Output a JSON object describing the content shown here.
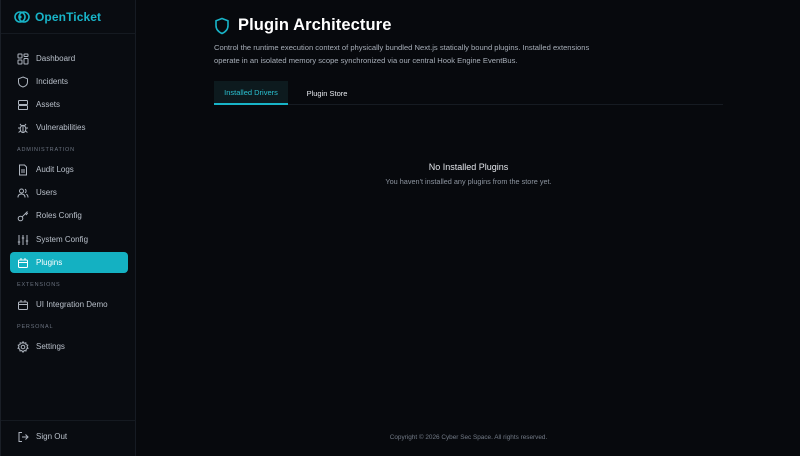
{
  "brand": {
    "name": "OpenTicket",
    "accent": "#18b4c8"
  },
  "sidebar": {
    "items": [
      {
        "label": "Dashboard",
        "icon": "dashboard-icon"
      },
      {
        "label": "Incidents",
        "icon": "shield-icon"
      },
      {
        "label": "Assets",
        "icon": "server-icon"
      },
      {
        "label": "Vulnerabilities",
        "icon": "bug-icon"
      }
    ],
    "sections": {
      "administration": "ADMINISTRATION",
      "extensions": "EXTENSIONS",
      "personal": "PERSONAL"
    },
    "admin_items": [
      {
        "label": "Audit Logs",
        "icon": "file-icon"
      },
      {
        "label": "Users",
        "icon": "users-icon"
      },
      {
        "label": "Roles Config",
        "icon": "key-icon"
      },
      {
        "label": "System Config",
        "icon": "sliders-icon"
      },
      {
        "label": "Plugins",
        "icon": "plugin-icon",
        "active": true
      }
    ],
    "extension_items": [
      {
        "label": "UI Integration Demo",
        "icon": "plugin-icon"
      }
    ],
    "personal_items": [
      {
        "label": "Settings",
        "icon": "gear-icon"
      }
    ],
    "sign_out": "Sign Out"
  },
  "main": {
    "title": "Plugin Architecture",
    "description": "Control the runtime execution context of physically bundled Next.js statically bound plugins. Installed extensions operate in an isolated memory scope synchronized via our central Hook Engine EventBus.",
    "tabs": [
      {
        "label": "Installed Drivers",
        "active": true
      },
      {
        "label": "Plugin Store",
        "active": false
      }
    ],
    "empty_state": {
      "title": "No Installed Plugins",
      "subtitle": "You haven't installed any plugins from the store yet."
    },
    "footer": "Copyright © 2026 Cyber Sec Space. All rights reserved."
  }
}
